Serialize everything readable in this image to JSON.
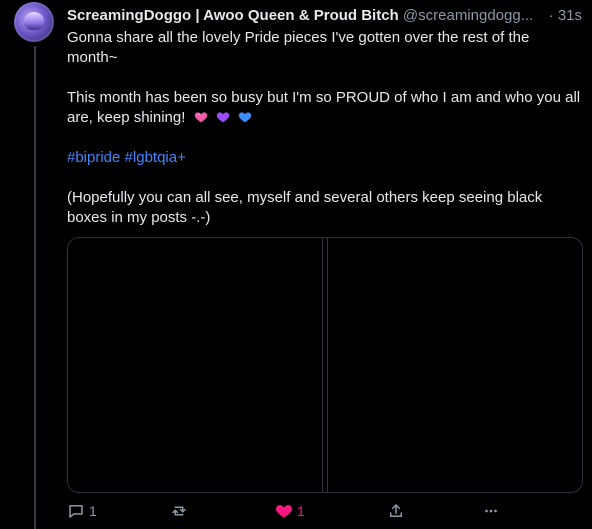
{
  "post": {
    "author_name": "ScreamingDoggo | Awoo Queen & Proud Bitch",
    "handle": "@screamingdogg...",
    "separator": "·",
    "time": "31s",
    "lines": [
      "Gonna share all the lovely Pride pieces I've gotten over the rest of the month~",
      "This month has been so busy but I'm so PROUD of who I am and who you all are, keep shining!",
      "(Hopefully you can all see, myself and several others keep seeing black boxes in my posts -.-)"
    ],
    "hashtags": [
      "#bipride",
      "#lgbtqia+"
    ],
    "emoji_icons": [
      "pink-heart-icon",
      "purple-heart-icon",
      "blue-heart-icon"
    ],
    "colors": {
      "pink": "#f45aa9",
      "purple": "#9b4dff",
      "blue": "#3b8cff",
      "link": "#3f86ff"
    }
  },
  "actions": {
    "reply_count": "1",
    "like_count": "1",
    "like_color": "#f91880"
  }
}
